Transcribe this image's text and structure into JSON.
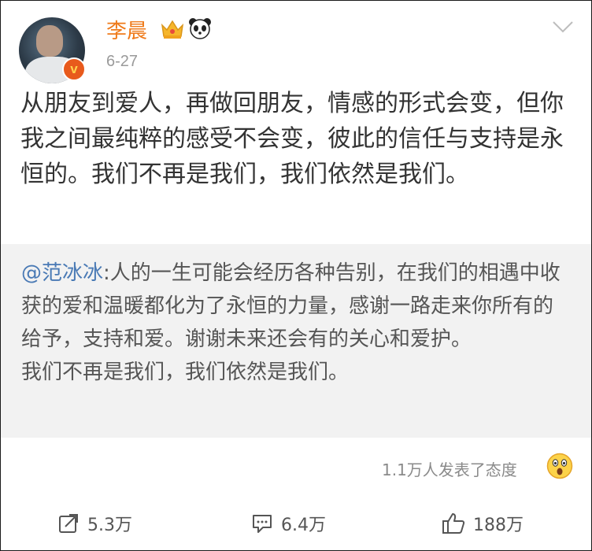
{
  "post": {
    "username": "李晨",
    "date": "6-27",
    "badge": "v",
    "text": "从朋友到爱人，再做回朋友，情感的形式会变，但你我之间最纯粹的感受不会变，彼此的信任与支持是永恒的。我们不再是我们，我们依然是我们。"
  },
  "repost": {
    "mention": "@范冰冰",
    "text_line1": ":人的一生可能会经历各种告别，在我们的相遇中收获的爱和温暖都化为了永恒的力量，感谢一路走来你所有的给予，支持和爱。谢谢未来还会有的关心和爱护。",
    "text_line2": "我们不再是我们，我们依然是我们。"
  },
  "reactions": {
    "text": "1.1万人发表了态度"
  },
  "actions": {
    "repost_count": "5.3万",
    "comment_count": "6.4万",
    "like_count": "188万"
  },
  "colors": {
    "username": "#ef7a1a",
    "mention": "#4a7ab5",
    "repost_bg": "#f2f2f2",
    "verified_badge": "#e85a1c"
  },
  "icons": [
    "crown-icon",
    "panda-icon",
    "chevron-down-icon",
    "verified-badge-icon",
    "wow-emoji-icon",
    "repost-icon",
    "comment-icon",
    "like-icon"
  ]
}
